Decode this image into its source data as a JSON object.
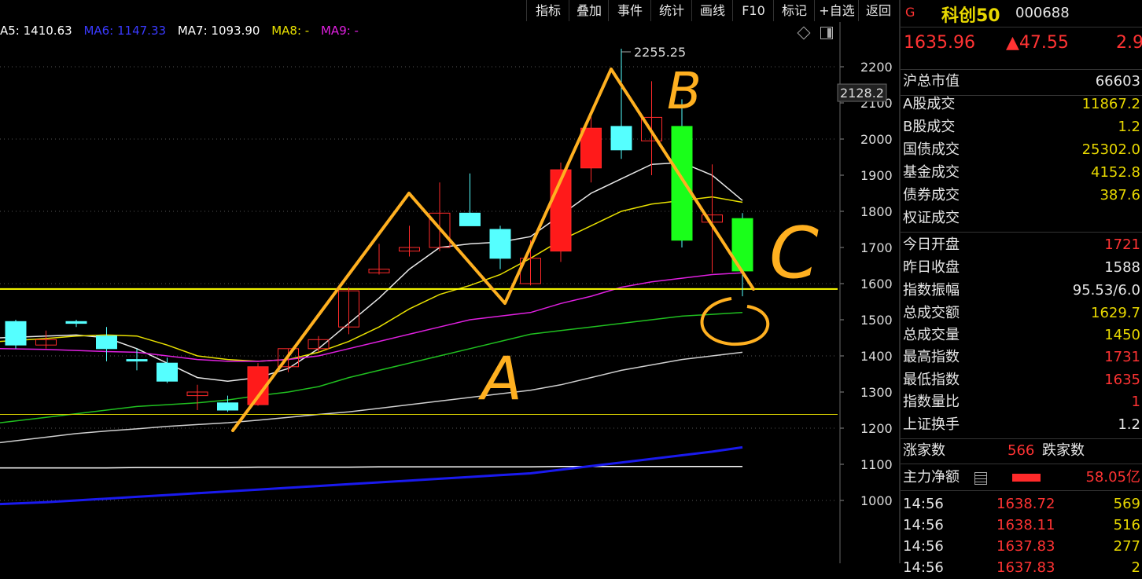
{
  "toolbar": {
    "buttons": [
      "指标",
      "叠加",
      "事件",
      "统计",
      "画线",
      "F10",
      "标记",
      "+自选",
      "返回"
    ]
  },
  "ma_legend": {
    "ma5": "A5: 1410.63",
    "ma6": "MA6: 1147.33",
    "ma7": "MA7: 1093.90",
    "ma8": "MA8: -",
    "ma9": "MA9: -",
    "colors": {
      "ma5": "#ffffff",
      "ma6": "#2222ee",
      "ma7": "#ffffff",
      "ma8": "#e8e000",
      "ma9": "#e020e0"
    }
  },
  "chart_data": {
    "type": "candlestick",
    "ylim": [
      950,
      2300
    ],
    "y_ticks": [
      "2200",
      "2100",
      "2000",
      "1900",
      "1800",
      "1700",
      "1600",
      "1500",
      "1400",
      "1300",
      "1200",
      "1100",
      "1000"
    ],
    "current_price_label": "2128.2",
    "high_annotation": "2255.25",
    "candles": [
      {
        "o": 1430,
        "c": 1495,
        "h": 1500,
        "l": 1420,
        "up": false
      },
      {
        "o": 1430,
        "c": 1445,
        "h": 1470,
        "l": 1420,
        "up": true
      },
      {
        "o": 1495,
        "c": 1490,
        "h": 1500,
        "l": 1480,
        "up": false
      },
      {
        "o": 1455,
        "c": 1420,
        "h": 1480,
        "l": 1385,
        "up": false
      },
      {
        "o": 1390,
        "c": 1390,
        "h": 1420,
        "l": 1360,
        "up": false
      },
      {
        "o": 1380,
        "c": 1330,
        "h": 1395,
        "l": 1325,
        "up": false
      },
      {
        "o": 1290,
        "c": 1300,
        "h": 1320,
        "l": 1250,
        "up": true
      },
      {
        "o": 1270,
        "c": 1250,
        "h": 1290,
        "l": 1245,
        "up": false
      },
      {
        "o": 1265,
        "c": 1370,
        "h": 1380,
        "l": 1262,
        "up": true
      },
      {
        "o": 1370,
        "c": 1420,
        "h": 1420,
        "l": 1355,
        "up": true
      },
      {
        "o": 1420,
        "c": 1445,
        "h": 1455,
        "l": 1410,
        "up": true
      },
      {
        "o": 1480,
        "c": 1580,
        "h": 1590,
        "l": 1460,
        "up": true
      },
      {
        "o": 1630,
        "c": 1640,
        "h": 1710,
        "l": 1625,
        "up": true
      },
      {
        "o": 1690,
        "c": 1700,
        "h": 1760,
        "l": 1675,
        "up": true
      },
      {
        "o": 1700,
        "c": 1795,
        "h": 1880,
        "l": 1690,
        "up": true
      },
      {
        "o": 1795,
        "c": 1760,
        "h": 1905,
        "l": 1760,
        "up": false
      },
      {
        "o": 1750,
        "c": 1670,
        "h": 1760,
        "l": 1640,
        "up": false
      },
      {
        "o": 1600,
        "c": 1670,
        "h": 1720,
        "l": 1595,
        "up": true
      },
      {
        "o": 1690,
        "c": 1915,
        "h": 1935,
        "l": 1660,
        "up": true
      },
      {
        "o": 1920,
        "c": 2030,
        "h": 2075,
        "l": 1880,
        "up": true
      },
      {
        "o": 2035,
        "c": 1970,
        "h": 2250,
        "l": 1945,
        "up": false
      },
      {
        "o": 1995,
        "c": 2060,
        "h": 2160,
        "l": 1900,
        "up": true
      },
      {
        "o": 2035,
        "c": 1720,
        "h": 2110,
        "l": 1700,
        "up": false
      },
      {
        "o": 1770,
        "c": 1790,
        "h": 1930,
        "l": 1630,
        "up": true
      },
      {
        "o": 1780,
        "c": 1635,
        "h": 1795,
        "l": 1565,
        "up": false
      }
    ],
    "ma_lines": {
      "white_fast": [
        1450,
        1455,
        1458,
        1450,
        1420,
        1380,
        1340,
        1330,
        1340,
        1365,
        1420,
        1490,
        1560,
        1640,
        1700,
        1710,
        1715,
        1730,
        1790,
        1850,
        1890,
        1930,
        1935,
        1900,
        1830
      ],
      "yellow": [
        1440,
        1448,
        1455,
        1458,
        1455,
        1430,
        1400,
        1390,
        1385,
        1390,
        1410,
        1440,
        1480,
        1530,
        1570,
        1595,
        1625,
        1670,
        1720,
        1760,
        1800,
        1820,
        1830,
        1840,
        1825
      ],
      "magenta": [
        1420,
        1418,
        1415,
        1412,
        1410,
        1400,
        1390,
        1385,
        1385,
        1390,
        1400,
        1420,
        1440,
        1460,
        1480,
        1500,
        1510,
        1520,
        1545,
        1565,
        1590,
        1605,
        1615,
        1625,
        1630
      ],
      "green": [
        1215,
        1230,
        1240,
        1250,
        1260,
        1265,
        1270,
        1278,
        1290,
        1300,
        1315,
        1340,
        1360,
        1380,
        1400,
        1420,
        1440,
        1460,
        1470,
        1480,
        1490,
        1500,
        1510,
        1515,
        1520
      ],
      "gray": [
        1160,
        1175,
        1185,
        1192,
        1198,
        1205,
        1210,
        1215,
        1222,
        1230,
        1238,
        1245,
        1255,
        1265,
        1275,
        1285,
        1295,
        1305,
        1320,
        1340,
        1360,
        1375,
        1390,
        1400,
        1410
      ],
      "white_slow": [
        1090,
        1090,
        1090,
        1090,
        1091,
        1091,
        1091,
        1091,
        1092,
        1092,
        1092,
        1092,
        1093,
        1093,
        1093,
        1093,
        1093,
        1093,
        1094,
        1094,
        1094,
        1094,
        1094,
        1094,
        1094
      ],
      "blue": [
        990,
        995,
        1000,
        1005,
        1010,
        1015,
        1020,
        1025,
        1030,
        1035,
        1040,
        1045,
        1050,
        1055,
        1060,
        1065,
        1070,
        1075,
        1085,
        1095,
        1105,
        1115,
        1125,
        1135,
        1147
      ]
    },
    "hlines": [
      {
        "y": 1585,
        "color": "#ffff00"
      },
      {
        "y": 1238,
        "color": "#d8d000"
      }
    ],
    "annotations": [
      "B",
      "A",
      "C"
    ]
  },
  "quote": {
    "badge": "G",
    "name": "科创50",
    "code": "000688",
    "price": "1635.96",
    "change": "▲47.55",
    "pct": "2.9",
    "rows": [
      {
        "label": "沪总市值",
        "value": "66603",
        "color": "#e6e6e6"
      },
      {
        "label": "A股成交",
        "value": "11867.2",
        "color": "#e8d800"
      },
      {
        "label": "B股成交",
        "value": "1.2",
        "color": "#e8d800"
      },
      {
        "label": "国债成交",
        "value": "25302.0",
        "color": "#e8d800"
      },
      {
        "label": "基金成交",
        "value": "4152.8",
        "color": "#e8d800"
      },
      {
        "label": "债券成交",
        "value": "387.6",
        "color": "#e8d800"
      },
      {
        "label": "权证成交",
        "value": "",
        "color": "#e8d800"
      },
      {
        "label": "今日开盘",
        "value": "1721",
        "color": "#ff3333"
      },
      {
        "label": "昨日收盘",
        "value": "1588",
        "color": "#e6e6e6"
      },
      {
        "label": "指数振幅",
        "value": "95.53/6.0",
        "color": "#e6e6e6"
      },
      {
        "label": "总成交额",
        "value": "1629.7",
        "color": "#e8d800"
      },
      {
        "label": "总成交量",
        "value": "1450",
        "color": "#e8d800"
      },
      {
        "label": "最高指数",
        "value": "1731",
        "color": "#ff3333"
      },
      {
        "label": "最低指数",
        "value": "1635",
        "color": "#ff3333"
      },
      {
        "label": "指数量比",
        "value": "1",
        "color": "#ff3333"
      },
      {
        "label": "上证换手",
        "value": "1.2",
        "color": "#e6e6e6"
      }
    ],
    "rise_label": "涨家数",
    "rise_count": "566",
    "fall_label": "跌家数",
    "main_flow_label": "主力净额",
    "main_flow_value": "58.05亿",
    "ticks": [
      {
        "time": "14:56",
        "price": "1638.72",
        "vol": "569"
      },
      {
        "time": "14:56",
        "price": "1638.11",
        "vol": "516"
      },
      {
        "time": "14:56",
        "price": "1637.83",
        "vol": "277"
      },
      {
        "time": "14:56",
        "price": "1637.83",
        "vol": "2"
      }
    ]
  }
}
